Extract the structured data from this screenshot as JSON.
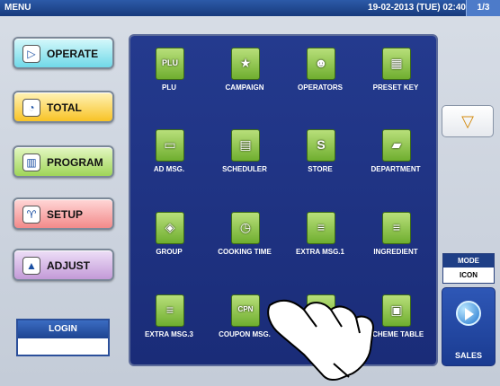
{
  "topbar": {
    "title": "MENU",
    "datetime": "19-02-2013 (TUE) 02:40",
    "page": "1/3"
  },
  "left_buttons": [
    {
      "label": "OPERATE",
      "glyph": "▷"
    },
    {
      "label": "TOTAL",
      "glyph": "◔"
    },
    {
      "label": "PROGRAM",
      "glyph": "▥"
    },
    {
      "label": "SETUP",
      "glyph": "♈"
    },
    {
      "label": "ADJUST",
      "glyph": "▲"
    }
  ],
  "login": {
    "label": "LOGIN"
  },
  "tiles": [
    {
      "label": "PLU",
      "glyph": "PLU",
      "icon": "plu-icon"
    },
    {
      "label": "CAMPAIGN",
      "glyph": "★",
      "icon": "star-icon"
    },
    {
      "label": "OPERATORS",
      "glyph": "☻",
      "icon": "person-icon"
    },
    {
      "label": "PRESET KEY",
      "glyph": "▦",
      "icon": "keypad-icon"
    },
    {
      "label": "AD MSG.",
      "glyph": "▭",
      "icon": "monitor-icon"
    },
    {
      "label": "SCHEDULER",
      "glyph": "▤",
      "icon": "calendar-icon"
    },
    {
      "label": "STORE",
      "glyph": "S",
      "icon": "store-icon"
    },
    {
      "label": "DEPARTMENT",
      "glyph": "▰",
      "icon": "folder-icon"
    },
    {
      "label": "GROUP",
      "glyph": "◈",
      "icon": "group-icon"
    },
    {
      "label": "COOKING TIME",
      "glyph": "◷",
      "icon": "timer-icon"
    },
    {
      "label": "EXTRA MSG.1",
      "glyph": "≡",
      "icon": "message-icon"
    },
    {
      "label": "INGREDIENT",
      "glyph": "≡",
      "icon": "message-icon"
    },
    {
      "label": "EXTRA MSG.3",
      "glyph": "≡",
      "icon": "message-icon"
    },
    {
      "label": "COUPON MSG.",
      "glyph": "CPN",
      "icon": "coupon-icon"
    },
    {
      "label": "",
      "glyph": "",
      "icon": "hidden-icon"
    },
    {
      "label": "SCHEME TABLE",
      "glyph": "▣",
      "icon": "scheme-icon"
    }
  ],
  "side": {
    "down_arrow": "▽",
    "mode_label": "MODE",
    "mode_value": "ICON",
    "sales_label": "SALES"
  }
}
